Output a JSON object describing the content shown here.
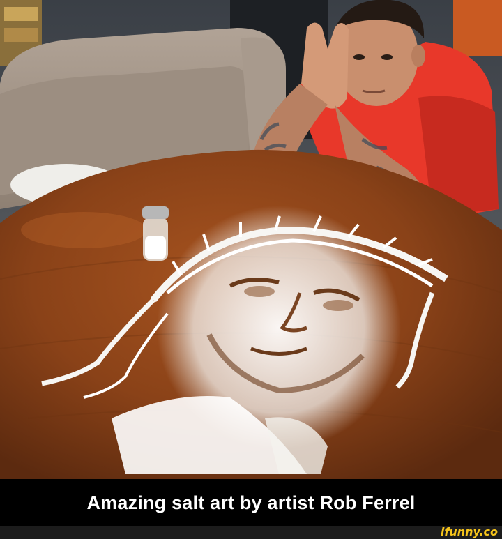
{
  "caption": "Amazing salt art by artist Rob Ferrel",
  "watermark": "ifunny.co",
  "colors": {
    "caption_bg": "#000000",
    "caption_text": "#ffffff",
    "watermark": "#f7c51b",
    "table_wood": "#8a4218",
    "shirt": "#e8382a",
    "couch": "#a39486"
  }
}
